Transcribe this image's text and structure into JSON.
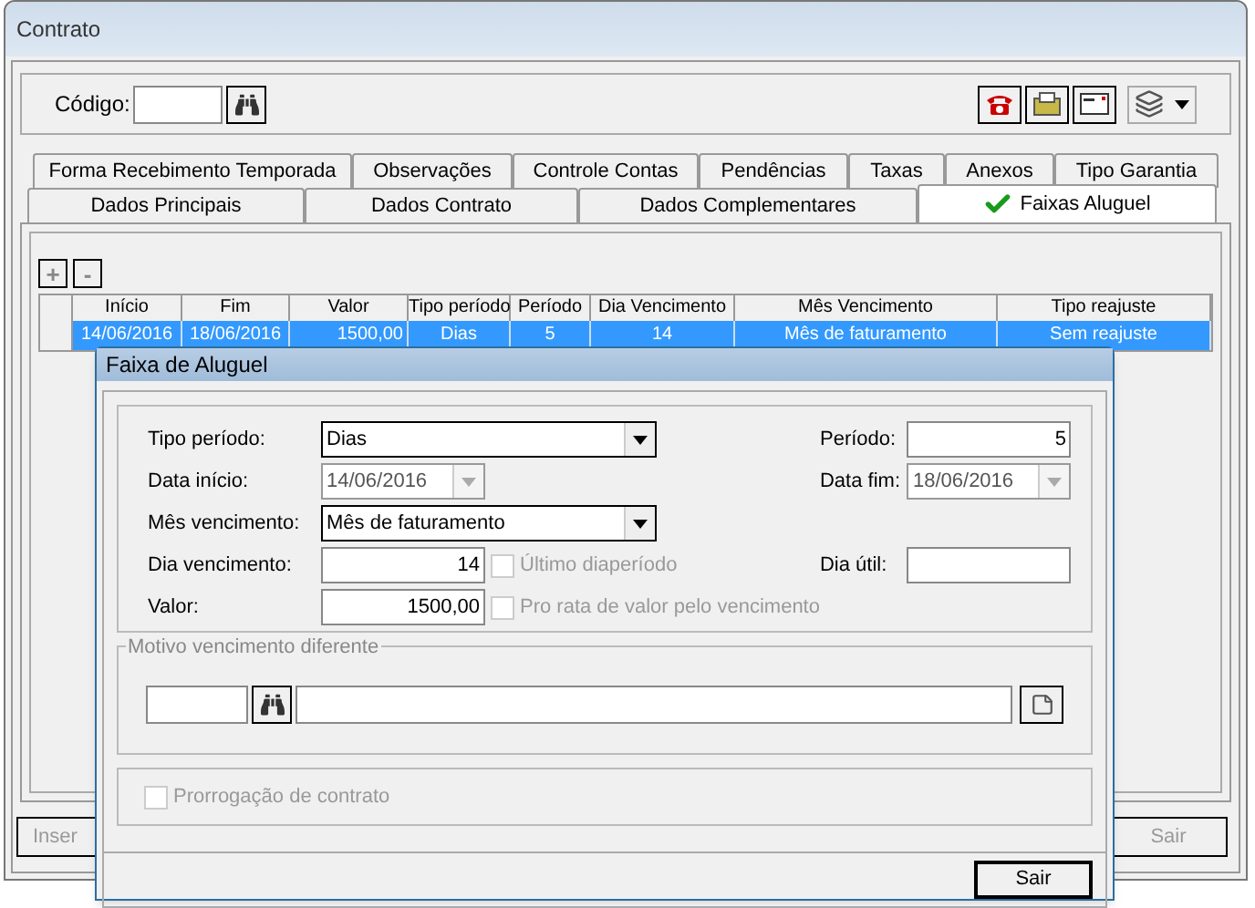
{
  "window": {
    "title": "Contrato"
  },
  "toolbar": {
    "code_label": "Código:"
  },
  "tabs_row1": [
    {
      "label": "Forma Recebimento Temporada",
      "selected": false
    },
    {
      "label": "Observações",
      "selected": false
    },
    {
      "label": "Controle Contas",
      "selected": false
    },
    {
      "label": "Pendências",
      "selected": false
    },
    {
      "label": "Taxas",
      "selected": false
    },
    {
      "label": "Anexos",
      "selected": false
    },
    {
      "label": "Tipo Garantia",
      "selected": false
    }
  ],
  "tabs_row2": [
    {
      "label": "Dados Principais",
      "selected": false
    },
    {
      "label": "Dados Contrato",
      "selected": false
    },
    {
      "label": "Dados Complementares",
      "selected": false
    },
    {
      "label": "Faixas Aluguel",
      "selected": true
    }
  ],
  "grid_buttons": [
    "+",
    "-"
  ],
  "table": {
    "columns": [
      "Início",
      "Fim",
      "Valor",
      "Tipo período",
      "Período",
      "Dia Vencimento",
      "Mês Vencimento",
      "Tipo reajuste"
    ],
    "rows": [
      {
        "selected": true,
        "cells": [
          "14/06/2016",
          "18/06/2016",
          "1500,00",
          "Dias",
          "5",
          "14",
          "Mês de faturamento",
          "Sem reajuste"
        ]
      }
    ]
  },
  "bottom_buttons": [
    {
      "label": "Inser",
      "disabled": true
    },
    {
      "label": "Sair",
      "disabled": true
    }
  ],
  "dialog": {
    "title": "Faixa de Aluguel",
    "tipo_periodo": {
      "label": "Tipo período:",
      "value": "Dias"
    },
    "periodo": {
      "label": "Período:",
      "value": "5"
    },
    "data_inicio": {
      "label": "Data início:",
      "value": "14/06/2016"
    },
    "data_fim": {
      "label": "Data fim:",
      "value": "18/06/2016"
    },
    "mes_vencimento": {
      "label": "Mês vencimento:",
      "value": "Mês de faturamento"
    },
    "dia_vencimento": {
      "label": "Dia vencimento:",
      "value": "14"
    },
    "ultimo_dia": {
      "label": "Último diaperíodo",
      "checked": false,
      "disabled": true
    },
    "dia_util": {
      "label": "Dia útil:"
    },
    "valor": {
      "label": "Valor:",
      "value": "1500,00"
    },
    "pro_rata": {
      "label": "Pro rata de valor pelo vencimento",
      "checked": false,
      "disabled": true
    },
    "motivo": {
      "legend": "Motivo vencimento diferente"
    },
    "prorrogacao": {
      "label": "Prorrogação de contrato",
      "checked": false,
      "disabled": true
    },
    "close_button": "Sair"
  }
}
